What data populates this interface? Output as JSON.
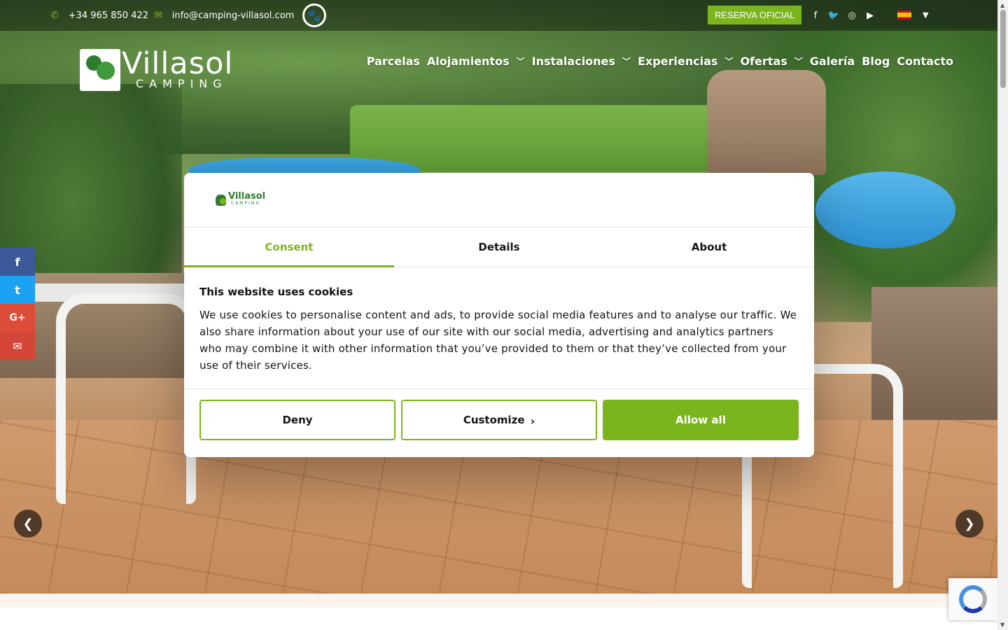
{
  "topbar": {
    "phone": "+34 965 850 422",
    "email": "info@camping-villasol.com",
    "pet_badge_icon": "paw-icon",
    "reserva_label": "RESERVA OFICIAL",
    "social_icons": [
      "facebook-icon",
      "twitter-icon",
      "instagram-icon",
      "youtube-icon"
    ],
    "language_flag": "spain-flag"
  },
  "logo": {
    "name": "Villasol",
    "tagline": "CAMPING"
  },
  "nav": {
    "items": [
      {
        "label": "Parcelas",
        "has_dropdown": false
      },
      {
        "label": "Alojamientos",
        "has_dropdown": true
      },
      {
        "label": "Instalaciones",
        "has_dropdown": true
      },
      {
        "label": "Experiencias",
        "has_dropdown": true
      },
      {
        "label": "Ofertas",
        "has_dropdown": true
      },
      {
        "label": "Galería",
        "has_dropdown": false
      },
      {
        "label": "Blog",
        "has_dropdown": false
      },
      {
        "label": "Contacto",
        "has_dropdown": false
      }
    ]
  },
  "share_bar": {
    "facebook": "f",
    "twitter": "t",
    "google": "G+",
    "mail": "✉"
  },
  "cookie_dialog": {
    "logo_name": "Villasol",
    "logo_tagline": "CAMPING",
    "tabs": [
      "Consent",
      "Details",
      "About"
    ],
    "active_tab": "Consent",
    "title": "This website uses cookies",
    "body": "We use cookies to personalise content and ads, to provide social media features and to analyse our traffic. We also share information about your use of our site with our social media, advertising and analytics partners who may combine it with other information that you’ve provided to them or that they’ve collected from your use of their services.",
    "buttons": {
      "deny": "Deny",
      "customize": "Customize",
      "allow_all": "Allow all"
    }
  },
  "colors": {
    "accent": "#7ab51d",
    "text": "#141414"
  }
}
